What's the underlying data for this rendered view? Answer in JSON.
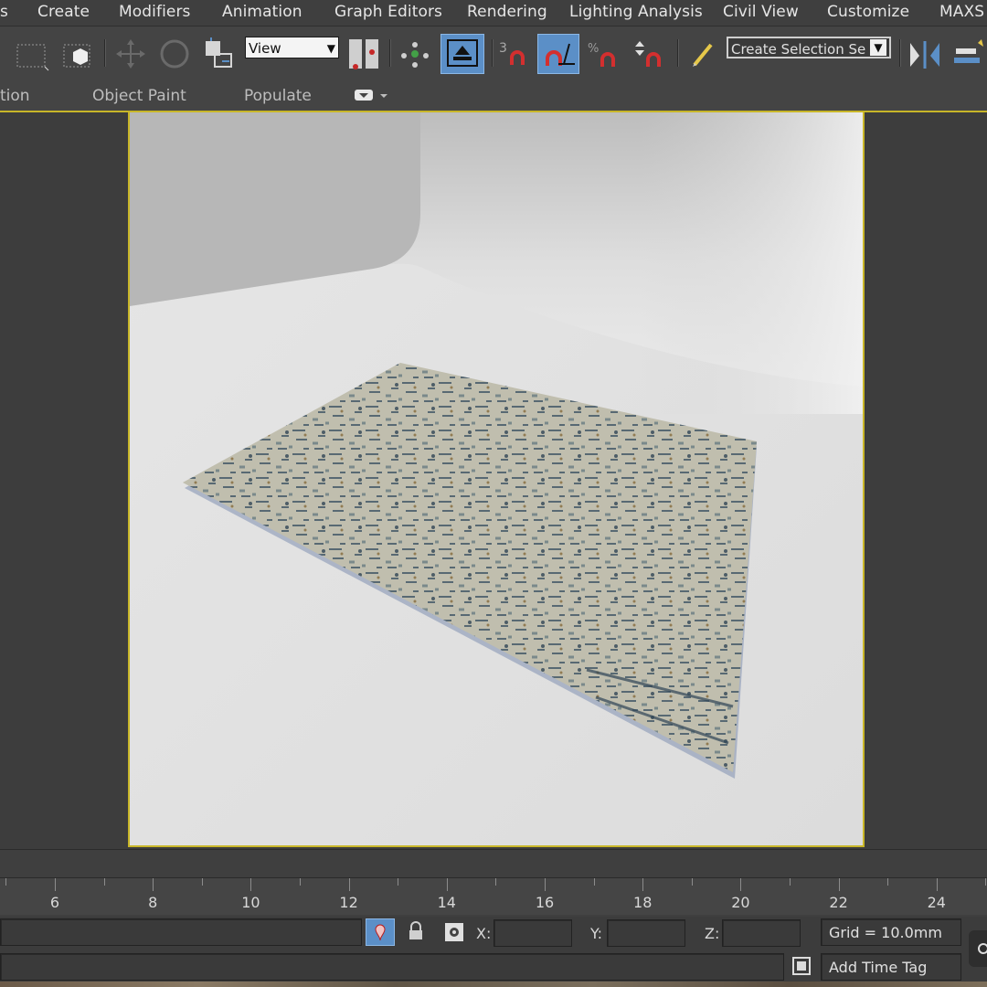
{
  "menubar": {
    "items": [
      {
        "label": "s"
      },
      {
        "label": "Create"
      },
      {
        "label": "Modifiers"
      },
      {
        "label": "Animation"
      },
      {
        "label": "Graph Editors"
      },
      {
        "label": "Rendering"
      },
      {
        "label": "Lighting Analysis"
      },
      {
        "label": "Civil View"
      },
      {
        "label": "Customize"
      },
      {
        "label": "MAXS"
      }
    ]
  },
  "toolbar": {
    "reference_coord_value": "View",
    "named_selection_value": "Create Selection Se",
    "icons": [
      "select-region-icon",
      "window-crossing-icon",
      "select-move-icon",
      "select-rotate-icon",
      "select-scale-icon",
      "reference-coordinate-icon",
      "use-pivot-center-icon",
      "select-and-manipulate-icon",
      "keyboard-shortcut-override-icon",
      "snaps-toggle-icon",
      "angle-snap-icon",
      "percent-snap-icon",
      "spinner-snap-icon",
      "edit-named-selection-icon",
      "mirror-icon",
      "align-icon"
    ]
  },
  "ribbon": {
    "tabs": [
      {
        "label": "tion"
      },
      {
        "label": "Object Paint"
      },
      {
        "label": "Populate"
      }
    ]
  },
  "timeline": {
    "ticks": [
      "6",
      "8",
      "10",
      "12",
      "14",
      "16",
      "18",
      "20",
      "22",
      "24"
    ]
  },
  "status": {
    "x_label": "X:",
    "y_label": "Y:",
    "z_label": "Z:",
    "x_value": "",
    "y_value": "",
    "z_value": "",
    "grid": "Grid = 10.0mm",
    "time_tag": "Add Time Tag"
  },
  "colors": {
    "viewport_border": "#c8b628",
    "active_tool": "#5b8fc7"
  }
}
